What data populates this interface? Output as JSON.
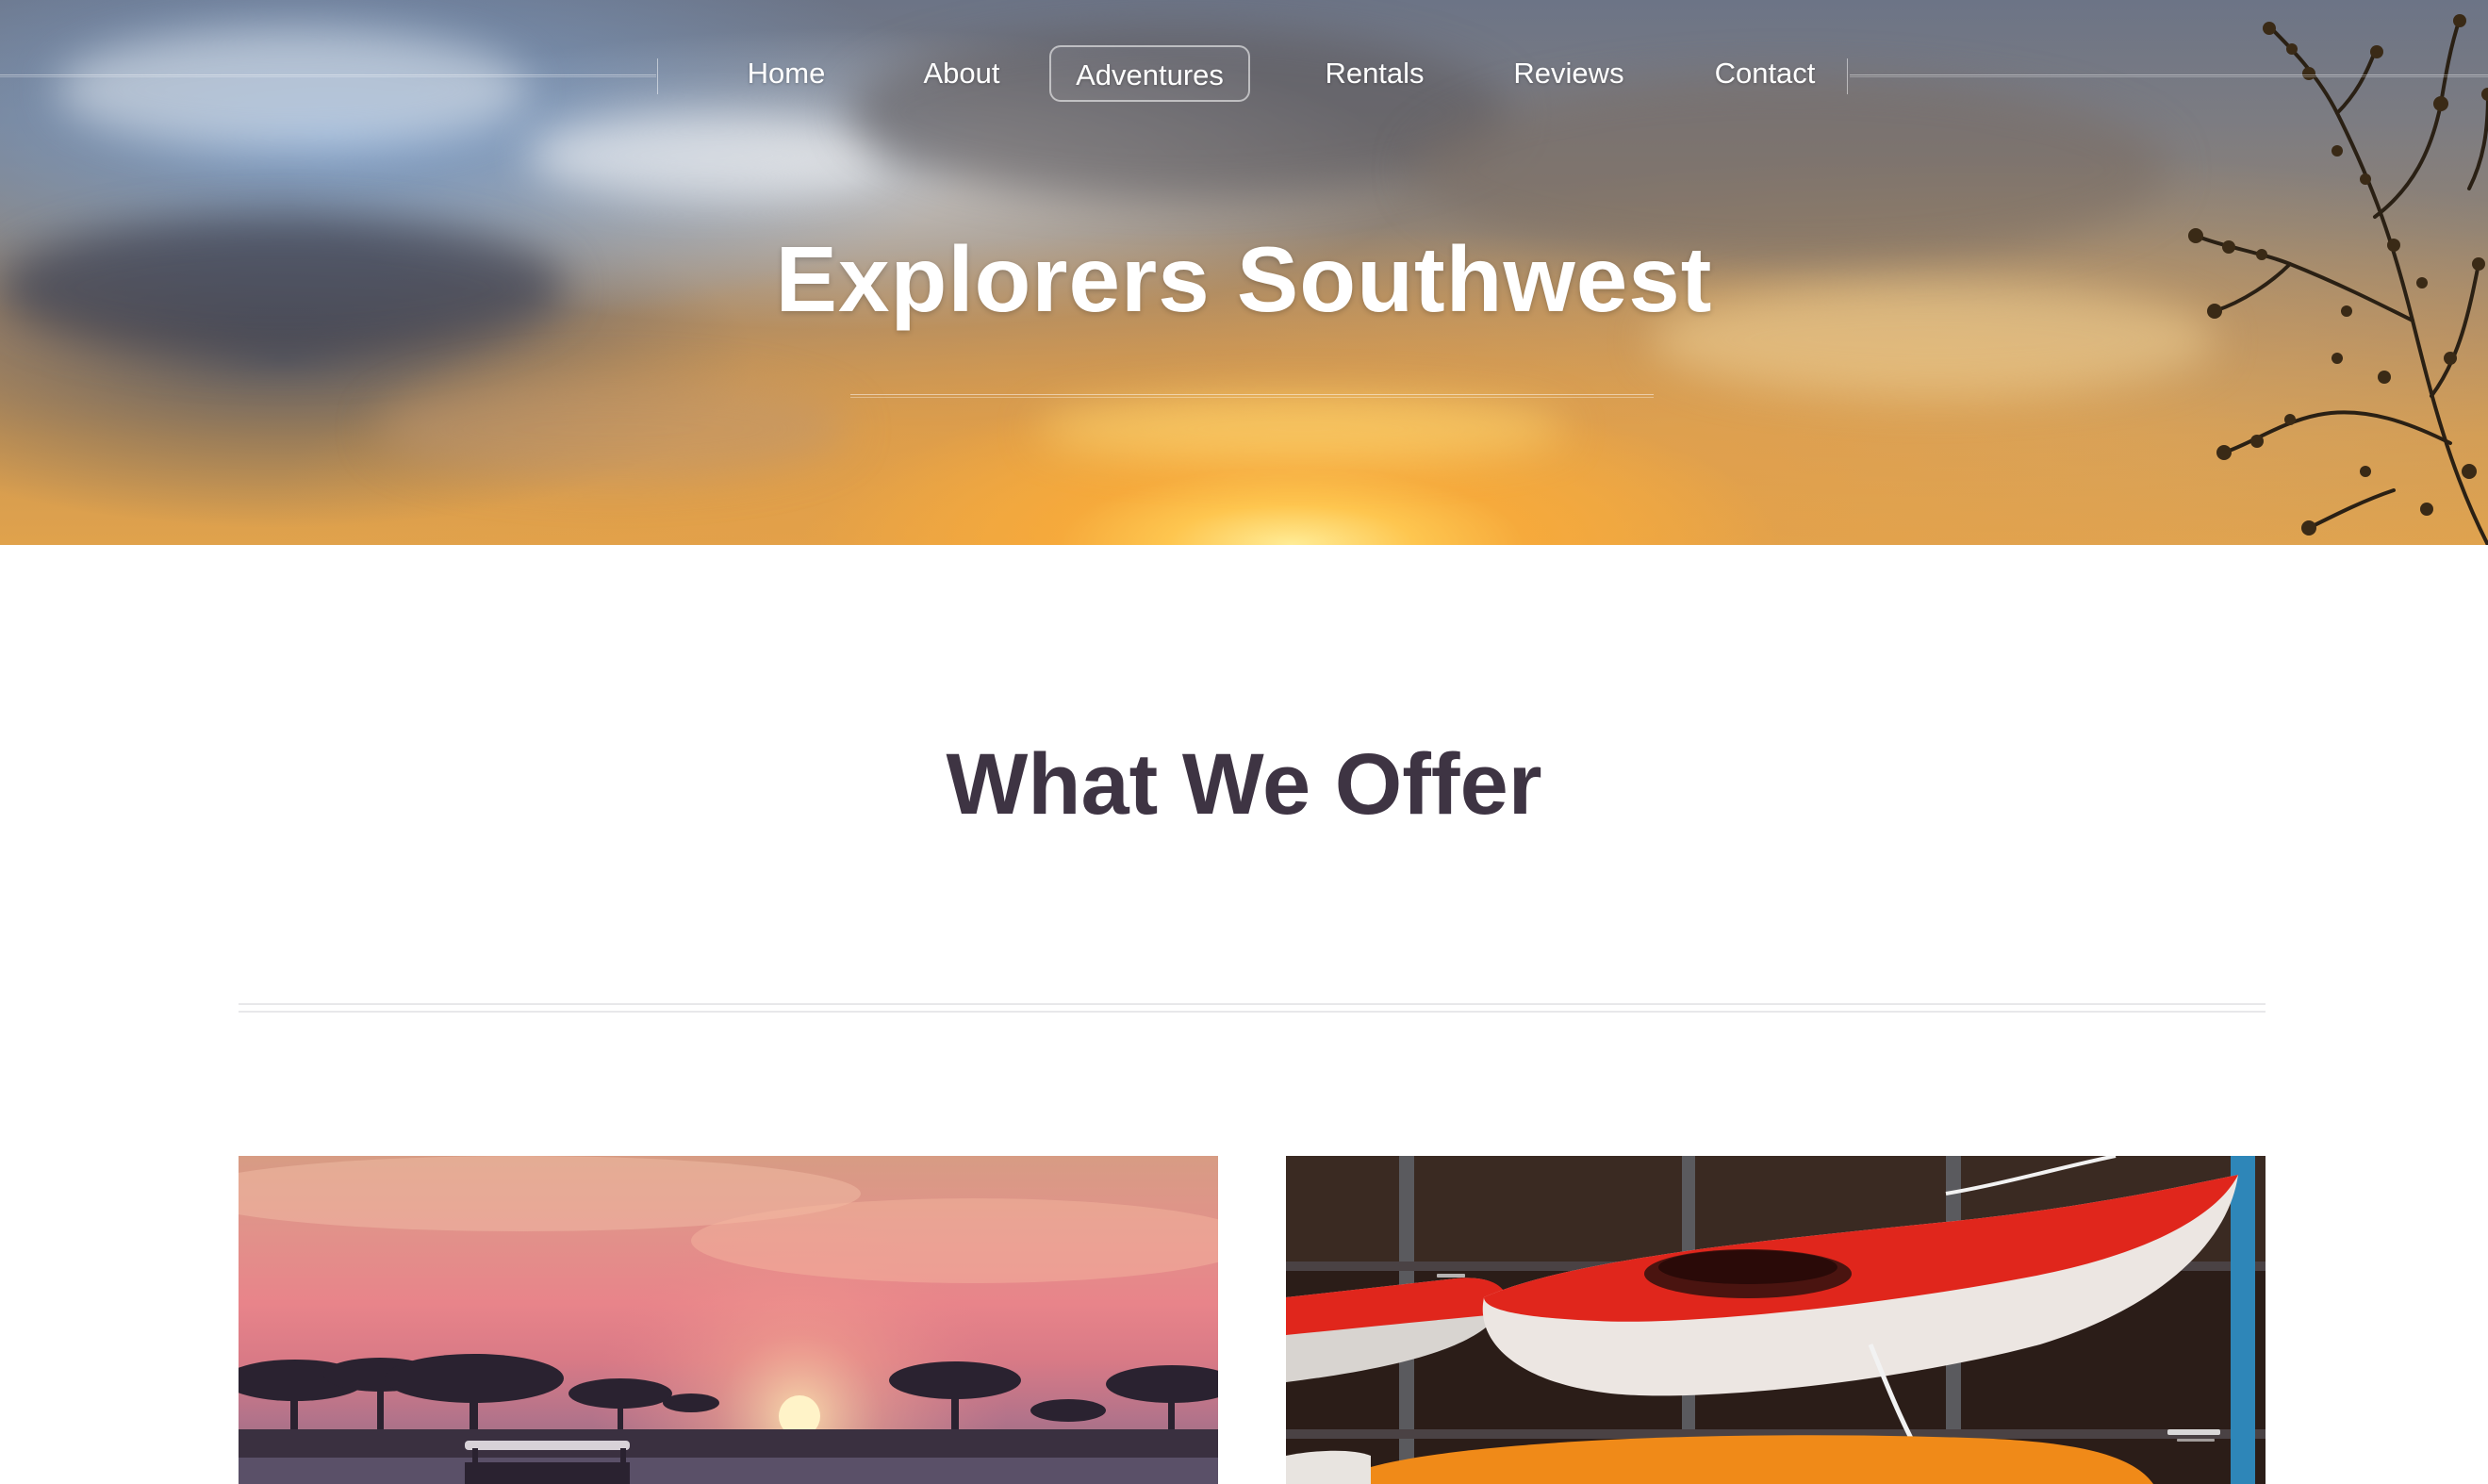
{
  "site": {
    "title": "Explorers Southwest"
  },
  "nav": {
    "items": [
      {
        "label": "Home"
      },
      {
        "label": "About"
      },
      {
        "label": "Adventures"
      },
      {
        "label": "Rentals"
      },
      {
        "label": "Reviews"
      },
      {
        "label": "Contact"
      }
    ],
    "active_index": 2
  },
  "main": {
    "section_title": "What We Offer"
  },
  "cards": [
    {
      "photo": "safari-sunset-photo"
    },
    {
      "photo": "kayak-rack-photo"
    }
  ],
  "colors": {
    "heading": "#3e3443",
    "kayak_red": "#e0261c",
    "kayak_orange": "#f08a18"
  }
}
